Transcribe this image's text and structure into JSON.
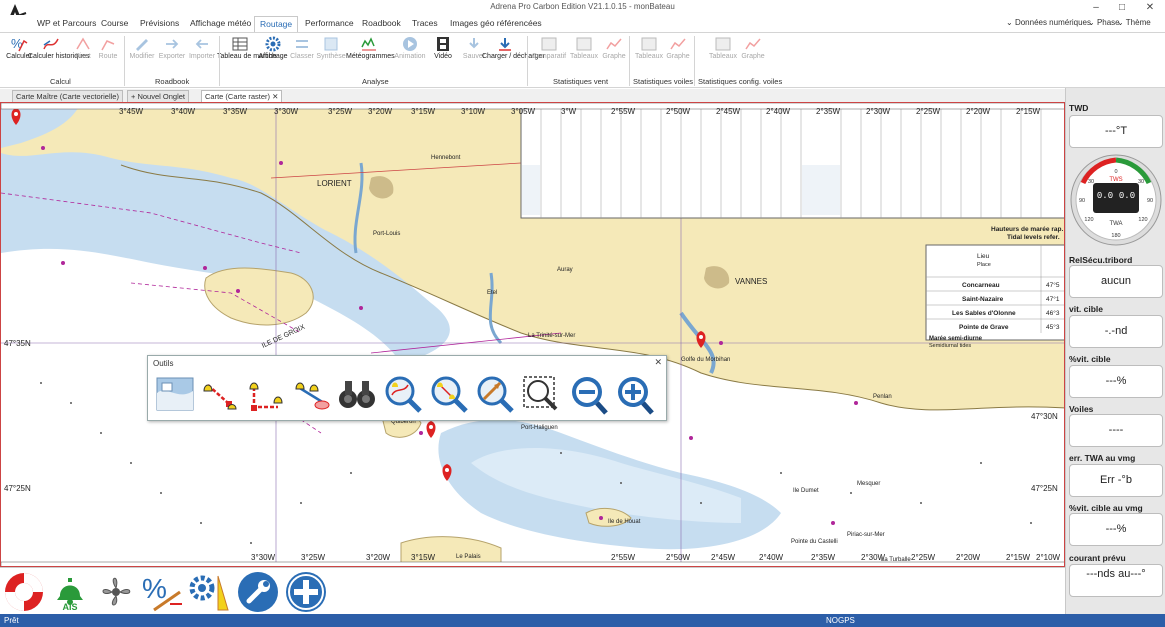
{
  "app": {
    "title": "Adrena Pro Carbon Edition V21.1.0.15 - monBateau",
    "window_controls": [
      "–",
      "□",
      "✕"
    ]
  },
  "menu": {
    "tabs": [
      "WP et Parcours",
      "Course",
      "Prévisions",
      "Affichage météo",
      "Routage",
      "Performance",
      "Roadbook",
      "Traces",
      "Images géo référencées"
    ],
    "active_tab": "Routage",
    "right": [
      "Données numériques",
      "Phase",
      "Thème"
    ]
  },
  "ribbon": {
    "buttons": [
      {
        "label": "Calculer",
        "icon": "routing-calc-icon",
        "disabled": false
      },
      {
        "label": "Calculer historiques",
        "icon": "routing-history-icon",
        "disabled": false
      },
      {
        "label": "Pivot",
        "icon": "pivot-icon",
        "disabled": true
      },
      {
        "label": "Route",
        "icon": "route-icon",
        "disabled": true
      },
      {
        "label": "Modifier",
        "icon": "edit-icon",
        "disabled": true
      },
      {
        "label": "Exporter",
        "icon": "export-icon",
        "disabled": true
      },
      {
        "label": "Importer",
        "icon": "import-icon",
        "disabled": true
      },
      {
        "label": "Tableau de marche",
        "icon": "table-icon",
        "disabled": false
      },
      {
        "label": "Affichage",
        "icon": "gear-icon",
        "disabled": false
      },
      {
        "label": "Classer",
        "icon": "sort-icon",
        "disabled": true
      },
      {
        "label": "Synthèse",
        "icon": "summary-icon",
        "disabled": true
      },
      {
        "label": "Météogrammes",
        "icon": "meteogram-icon",
        "disabled": false
      },
      {
        "label": "Animation",
        "icon": "play-icon",
        "disabled": true
      },
      {
        "label": "Vidéo",
        "icon": "film-icon",
        "disabled": false
      },
      {
        "label": "Sauver",
        "icon": "save-icon",
        "disabled": true
      },
      {
        "label": "Charger / décharger",
        "icon": "load-icon",
        "disabled": false
      },
      {
        "label": "Comparatif",
        "icon": "compare-icon",
        "disabled": true
      },
      {
        "label": "Tableaux",
        "icon": "table-icon",
        "disabled": true
      },
      {
        "label": "Graphe",
        "icon": "graph-icon",
        "disabled": true
      },
      {
        "label": "Tableaux",
        "icon": "table-icon",
        "disabled": true
      },
      {
        "label": "Graphe",
        "icon": "graph-icon",
        "disabled": true
      },
      {
        "label": "Tableaux",
        "icon": "table-icon",
        "disabled": true
      },
      {
        "label": "Graphe",
        "icon": "graph-icon",
        "disabled": true
      }
    ],
    "groups": [
      "Calcul",
      "Roadbook",
      "Analyse",
      "Statistiques vent",
      "Statistiques voiles",
      "Statistiques config. voiles"
    ]
  },
  "doc_tabs": [
    "Carte Maître (Carte vectorielle)",
    "Nouvel Onglet",
    "Carte (Carte raster)"
  ],
  "map": {
    "top_lon_labels": [
      "3°45W",
      "3°40W",
      "3°35W",
      "3°30W",
      "3°25W",
      "3°20W",
      "3°15W",
      "3°10W",
      "3°05W",
      "3°W",
      "2°55W",
      "2°50W",
      "2°45W",
      "2°40W",
      "2°35W",
      "2°30W",
      "2°25W",
      "2°20W",
      "2°15W"
    ],
    "bottom_lon_labels": [
      "3°30W",
      "3°25W",
      "3°20W",
      "3°15W",
      "2°55W",
      "2°50W",
      "2°45W",
      "2°40W",
      "2°35W",
      "2°30W",
      "2°25W",
      "2°20W",
      "2°15W",
      "2°10W"
    ],
    "lat_labels": [
      "47°35N",
      "47°30N",
      "47°25N"
    ],
    "places": [
      "LORIENT",
      "ILE DE GROIX",
      "VANNES",
      "Auray",
      "Hennebont",
      "Port-Louis",
      "Etel",
      "La Trinité-sur-Mer",
      "Golfe du Morbihan",
      "Penlan",
      "Quiberon",
      "Ile de Houat",
      "Ile Dumet",
      "Mesquer",
      "Pointe du Castelli",
      "Le Palais",
      "La Turballe",
      "Piriac-sur-Mer",
      "Port-Haliguen"
    ],
    "tide_panel": {
      "title": "Hauteurs de marée rap.",
      "subtitle": "Tidal levels refer.",
      "col_lieu": "Lieu",
      "col_place": "Place",
      "rows": [
        {
          "name": "Concarneau",
          "lat": "47°5"
        },
        {
          "name": "Saint-Nazaire",
          "lat": "47°1"
        },
        {
          "name": "Les Sables d'Olonne",
          "lat": "46°3"
        },
        {
          "name": "Pointe de Grave",
          "lat": "45°3"
        }
      ],
      "note1": "Marée semi-diurne",
      "note2": "Semidiurnal tides"
    }
  },
  "toolbox": {
    "title": "Outils",
    "close": "✕",
    "tools": [
      "chart-select-icon",
      "route-create-icon",
      "route-edit-icon",
      "route-insert-icon",
      "binoculars-icon",
      "zoom-area-icon",
      "zoom-all-icon",
      "zoom-heading-icon",
      "zoom-box-icon",
      "zoom-out-icon",
      "zoom-in-icon"
    ]
  },
  "right_panel": {
    "items": [
      {
        "label": "TWD",
        "value": "---°T"
      },
      {
        "label": "RelSécu.tribord",
        "value": "aucun"
      },
      {
        "label": "vit. cible",
        "value": "-.-nd"
      },
      {
        "label": "%vit. cible",
        "value": "---%"
      },
      {
        "label": "Voiles",
        "value": "----"
      },
      {
        "label": "err. TWA au vmg",
        "value": "Err -°b"
      },
      {
        "label": "%vit. cible au vmg",
        "value": "---%"
      },
      {
        "label": "courant prévu",
        "value": "---nds au---°"
      }
    ],
    "gauge": {
      "top": "TWS",
      "bottom": "TWA",
      "left": "0.0",
      "right": "0.0",
      "scale": [
        "0",
        "30",
        "60",
        "90",
        "120",
        "150",
        "180"
      ]
    }
  },
  "bottom_buttons": [
    "lifebuoy-icon",
    "ais-bell-icon",
    "propeller-icon",
    "percent-polar-icon",
    "gear-sail-icon",
    "wrench-icon",
    "plus-icon"
  ],
  "bottom_ais_label": "AIS",
  "status": {
    "left": "Prêt",
    "center": "NOGPS"
  },
  "colors": {
    "land": "#f5e9b8",
    "shallow": "#c6ddf0",
    "sea": "#ffffff",
    "accent": "#2c5ea8",
    "magenta": "#b0269a"
  }
}
